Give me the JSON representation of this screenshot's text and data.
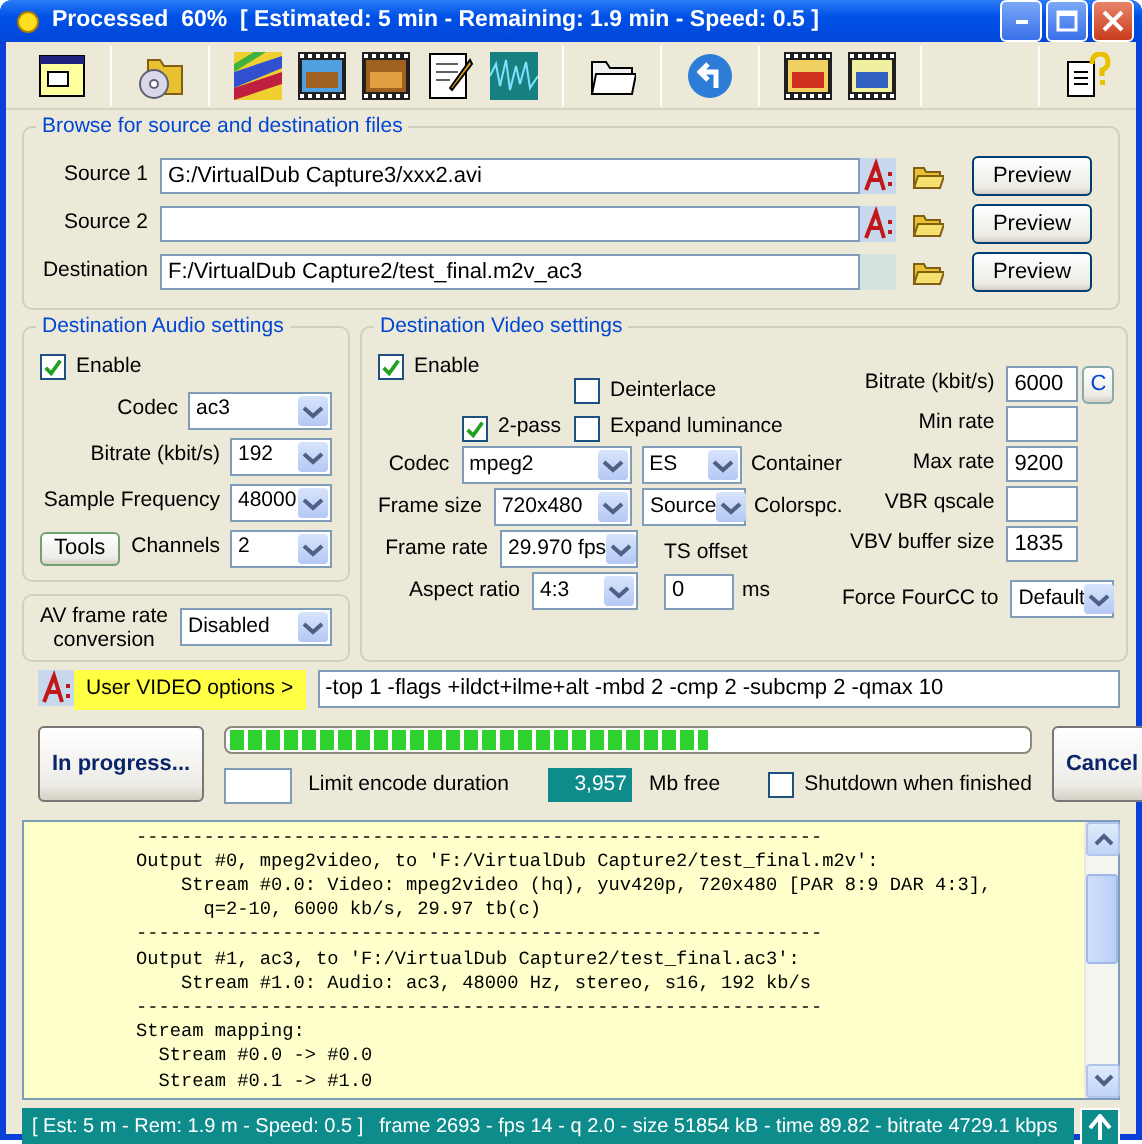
{
  "window": {
    "title": "Processed  60%  [ Estimated: 5 min - Remaining: 1.9 min - Speed: 0.5 ]"
  },
  "files": {
    "title": "Browse for source and destination files",
    "rows": [
      {
        "kind": "source",
        "label": "Source 1",
        "value": "G:/VirtualDub Capture3/xxx2.avi",
        "button": "Preview"
      },
      {
        "kind": "source",
        "label": "Source 2",
        "button": "Preview"
      },
      {
        "kind": "destination",
        "label": "Destination",
        "value": "F:/VirtualDub Capture2/test_final.m2v_ac3",
        "button": "Preview"
      }
    ]
  },
  "audio": {
    "title": "Destination Audio settings",
    "enable": {
      "label": "Enable",
      "checked": true
    },
    "tools_button": "Tools",
    "fields": [
      {
        "label": "Codec",
        "value": "ac3"
      },
      {
        "label": "Bitrate (kbit/s)",
        "value": "192"
      },
      {
        "label": "Sample Frequency",
        "value": "48000"
      },
      {
        "label": "Channels",
        "value": "2"
      }
    ]
  },
  "frame_rate_conversion": {
    "label": "AV frame rate conversion",
    "value": "Disabled"
  },
  "video": {
    "title": "Destination Video settings",
    "enable": {
      "label": "Enable",
      "checked": true
    },
    "two_pass": {
      "label": "2-pass",
      "checked": true
    },
    "deinterlace": {
      "label": "Deinterlace",
      "checked": false
    },
    "expand_luminance": {
      "label": "Expand luminance",
      "checked": false
    },
    "rows": [
      {
        "label": "Codec",
        "value": "mpeg2",
        "option": "ES",
        "option_label": "Container"
      },
      {
        "label": "Frame size",
        "value": "720x480",
        "option": "Source",
        "option_label": "Colorspc."
      },
      {
        "label": "Frame rate",
        "value": "29.970 fps"
      },
      {
        "label": "Aspect ratio",
        "value": "4:3"
      }
    ],
    "ts_offset": {
      "label": "TS offset",
      "value": "0",
      "unit": "ms"
    },
    "rates": [
      {
        "label": "Bitrate (kbit/s)",
        "value": "6000"
      },
      {
        "label": "Min rate"
      },
      {
        "label": "Max rate",
        "value": "9200"
      },
      {
        "label": "VBR qscale"
      },
      {
        "label": "VBV buffer size",
        "value": "1835"
      }
    ],
    "bitrate_button": "C",
    "fourcc": {
      "label": "Force FourCC to",
      "value": "Default"
    }
  },
  "user_options": {
    "label": "User VIDEO options >",
    "value": "-top 1 -flags +ildct+ilme+alt -mbd 2 -cmp 2 -subcmp 2 -qmax 10"
  },
  "progress": {
    "button": "In progress...",
    "level": 0.6,
    "cancel": "Cancel",
    "limit_label": "Limit encode duration",
    "free_space": "3,957",
    "free_label": "Mb free",
    "shutdown": {
      "label": "Shutdown when finished",
      "checked": false
    }
  },
  "log": {
    "lines": [
      "-------------------------------------------------------------",
      "Output #0, mpeg2video, to 'F:/VirtualDub Capture2/test_final.m2v':",
      "    Stream #0.0: Video: mpeg2video (hq), yuv420p, 720x480 [PAR 8:9 DAR 4:3],",
      "      q=2-10, 6000 kb/s, 29.97 tb(c)",
      "-------------------------------------------------------------",
      "Output #1, ac3, to 'F:/VirtualDub Capture2/test_final.ac3':",
      "    Stream #1.0: Audio: ac3, 48000 Hz, stereo, s16, 192 kb/s",
      "-------------------------------------------------------------",
      "Stream mapping:",
      "  Stream #0.0 -> #0.0",
      "  Stream #0.1 -> #1.0"
    ]
  },
  "status_bar": {
    "summary": "[ Est: 5 m - Rem: 1.9 m - Speed: 0.5 ]",
    "stats": "frame 2693 - fps 14 - q 2.0 - size 51854 kB - time 89.82 - bitrate 4729.1 kbps"
  }
}
